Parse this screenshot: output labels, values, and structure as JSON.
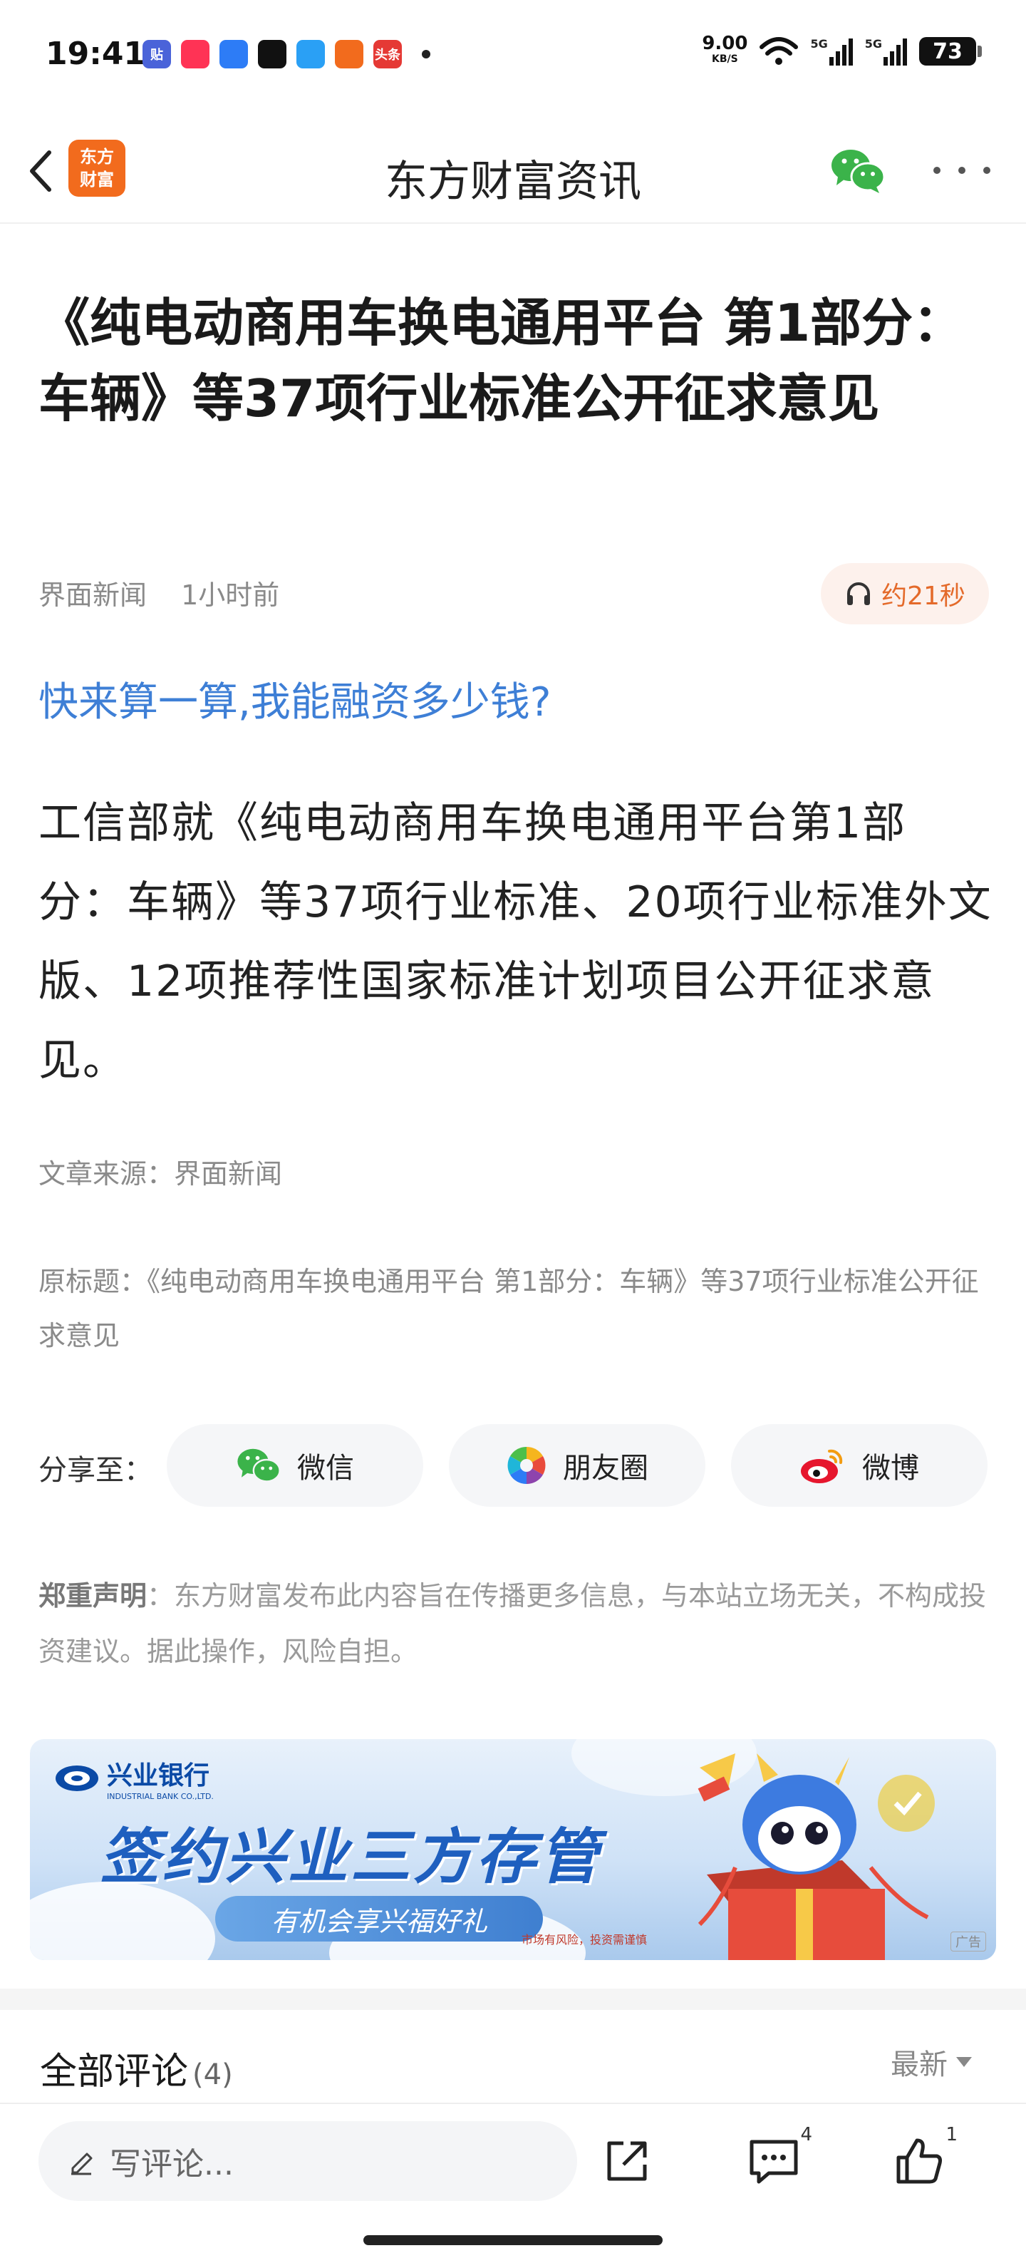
{
  "status_bar": {
    "time": "19:41",
    "apps": [
      {
        "icon": "tieba-icon",
        "label": "贴",
        "color": "#4a63d9"
      },
      {
        "icon": "music-icon",
        "label": "",
        "color": "#ff3355"
      },
      {
        "icon": "video-player-icon",
        "label": "",
        "color": "#2d7cf6"
      },
      {
        "icon": "tiktok-icon",
        "label": "",
        "color": "#111111"
      },
      {
        "icon": "browser-icon",
        "label": "",
        "color": "#2aa0f5"
      },
      {
        "icon": "send-icon",
        "label": "",
        "color": "#f26b1d"
      },
      {
        "icon": "toutiao-icon",
        "label": "头条",
        "color": "#e53935"
      }
    ],
    "net_speed": "9.00",
    "net_unit": "KB/S",
    "signal_1": "5G",
    "signal_2": "5G",
    "battery": "73"
  },
  "nav": {
    "back_icon": "chevron-left-icon",
    "logo_text": "东方财富",
    "title": "东方财富资讯",
    "wechat_icon": "wechat-icon",
    "more_icon": "more-icon"
  },
  "article": {
    "title": "《纯电动商用车换电通用平台 第1部分：车辆》等37项行业标准公开征求意见",
    "source_name": "界面新闻",
    "time_ago": "1小时前",
    "listen_label": "约21秒",
    "promo_link": "快来算一算,我能融资多少钱?",
    "body": "工信部就《纯电动商用车换电通用平台第1部分：车辆》等37项行业标准、20项行业标准外文版、12项推荐性国家标准计划项目公开征求意见。",
    "source_line": "文章来源：界面新闻",
    "original_title": "原标题：《纯电动商用车换电通用平台 第1部分：车辆》等37项行业标准公开征求意见"
  },
  "share": {
    "label": "分享至：",
    "buttons": [
      {
        "label": "微信",
        "icon": "wechat-icon"
      },
      {
        "label": "朋友圈",
        "icon": "moments-icon"
      },
      {
        "label": "微博",
        "icon": "weibo-icon"
      }
    ]
  },
  "disclaimer": {
    "heading": "郑重声明",
    "text": "：东方财富发布此内容旨在传播更多信息，与本站立场无关，不构成投资建议。据此操作，风险自担。"
  },
  "banner": {
    "bank_name": "兴业银行",
    "bank_name_en": "INDUSTRIAL BANK CO.,LTD.",
    "slogan": "签约兴业三方存管",
    "subline": "有机会享兴福好礼",
    "small_print": "市场有风险，投资需谨慎",
    "ad_tag": "广告"
  },
  "comments": {
    "title": "全部评论",
    "count": "(4)",
    "sort_label": "最新"
  },
  "bottom_bar": {
    "input_placeholder": "写评论...",
    "comment_badge": "4",
    "like_badge": "1"
  }
}
